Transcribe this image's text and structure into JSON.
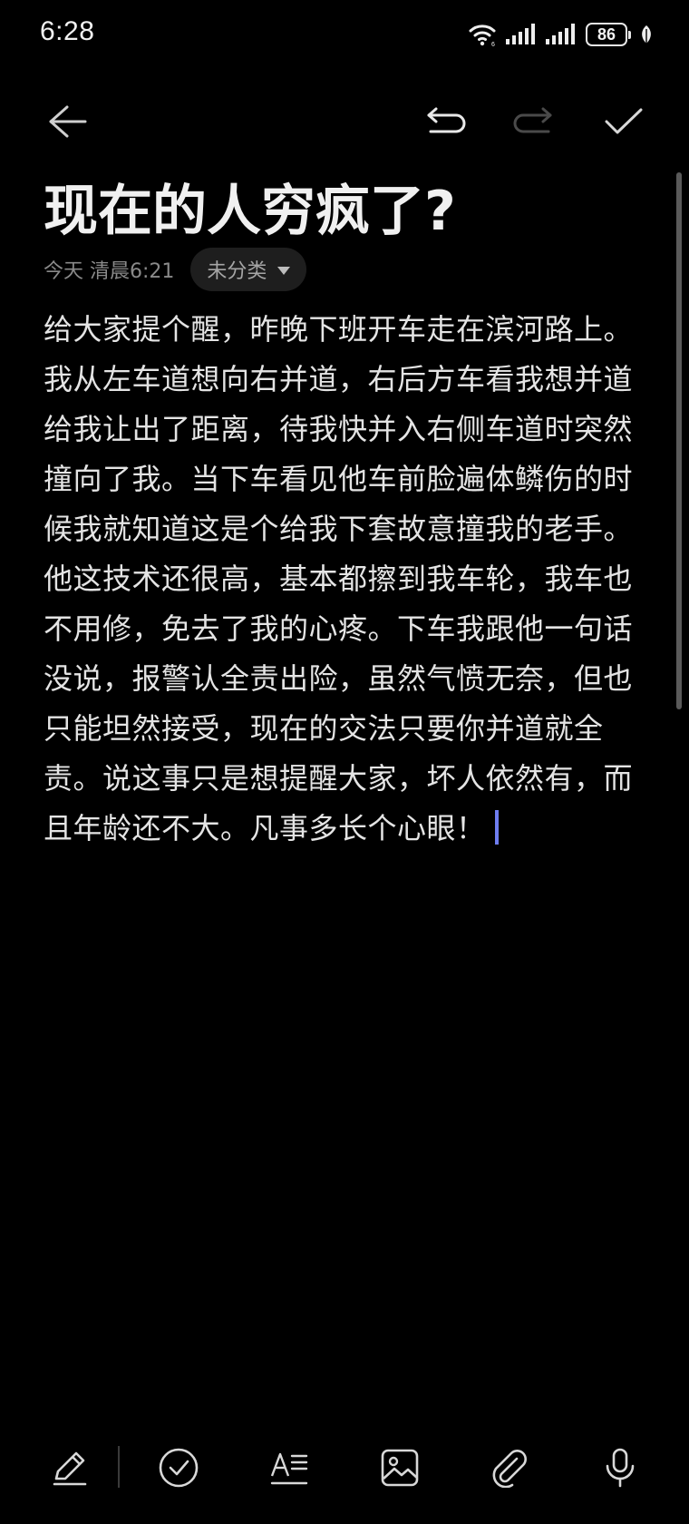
{
  "status_bar": {
    "time": "6:28",
    "battery": "86",
    "icons": [
      "wifi-icon",
      "signal-icon",
      "signal-icon",
      "battery-icon",
      "leaf-icon"
    ]
  },
  "toolbar": {
    "icons": [
      "back-arrow-icon",
      "undo-icon",
      "redo-icon",
      "check-icon"
    ]
  },
  "note": {
    "title": "现在的人穷疯了?",
    "date": "今天 清晨6:21",
    "category": "未分类",
    "lines": [
      "给大家提个醒，昨晚下班开车走在滨河路上。",
      "我从左车道想向右并道，右后方车看我想并道",
      "给我让出了距离，待我快并入右侧车道时突然",
      "撞向了我。当下车看见他车前脸遍体鳞伤的时",
      "候我就知道这是个给我下套故意撞我的老手。",
      "他这技术还很高，基本都擦到我车轮，我车也",
      "不用修，免去了我的心疼。下车我跟他一句话",
      "没说，报警认全责出险，虽然气愤无奈，但也",
      "只能坦然接受，现在的交法只要你并道就全",
      "责。说这事只是想提醒大家，坏人依然有，而",
      "且年龄还不大。凡事多长个心眼！"
    ]
  },
  "bottom_bar": {
    "icons": [
      "pen-icon",
      "checklist-icon",
      "text-format-icon",
      "image-icon",
      "attachment-icon",
      "microphone-icon"
    ]
  },
  "colors": {
    "background": "#000000",
    "text": "#e4e4e4",
    "cursor": "#6e7df0",
    "chip_bg": "#1e1e1e"
  }
}
